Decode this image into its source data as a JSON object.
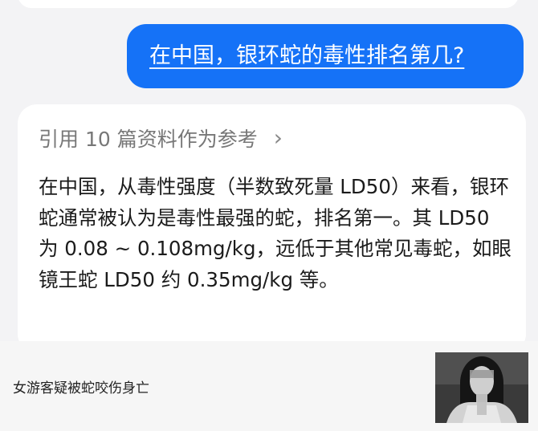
{
  "chat": {
    "user_question": "在中国，银环蛇的毒性排名第几?",
    "references_label": "引用 10 篇资料作为参考",
    "answer_text": "在中国，从毒性强度（半数致死量 LD50）来看，银环蛇通常被认为是毒性最强的蛇，排名第一。其 LD50 为 0.08 ~ 0.108mg/kg，远低于其他常见毒蛇，如眼镜王蛇 LD50 约 0.35mg/kg 等。"
  },
  "footer": {
    "caption": "女游客疑被蛇咬伤身亡"
  },
  "colors": {
    "accent_blue": "#1572f7",
    "bubble_white": "#ffffff",
    "background": "#f3f3f5"
  },
  "icons": {
    "references_chevron": "chevron-right-icon"
  }
}
